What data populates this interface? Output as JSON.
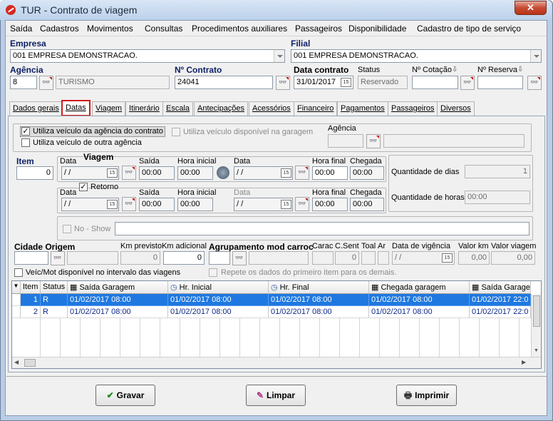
{
  "window": {
    "title": "TUR - Contrato de viagem",
    "close": "✕"
  },
  "menu": [
    "Saída",
    "Cadastros",
    "Movimentos",
    "Consultas",
    "Procedimentos auxiliares",
    "Passageiros",
    "Disponibilidade",
    "Cadastro de tipo de serviço"
  ],
  "header": {
    "empresa_label": "Empresa",
    "empresa_value": "001 EMPRESA DEMONSTRACAO.",
    "filial_label": "Filial",
    "filial_value": "001 EMPRESA DEMONSTRACAO.",
    "agencia_label": "Agência",
    "agencia_code": "8",
    "agencia_name": "TURISMO",
    "contrato_label": "Nº Contrato",
    "contrato_value": "24041",
    "data_contrato_label": "Data contrato",
    "data_contrato_value": "31/01/2017",
    "status_label": "Status",
    "status_value": "Reservado",
    "cotacao_label": "Nº Cotação",
    "reserva_label": "Nº Reserva"
  },
  "tabs": [
    "Dados gerais",
    "Datas",
    "Viagem",
    "Itinerário",
    "Escala",
    "Antecipações",
    "Acessórios",
    "Financeiro",
    "Pagamentos",
    "Passageiros",
    "Diversos"
  ],
  "datas": {
    "usa_veiculo_agencia": "Utiliza veículo da agência do contrato",
    "usa_veiculo_outra": "Utiliza veículo de outra agência",
    "usa_veiculo_garagem": "Utiliza veículo disponível na garagem",
    "agencia_label": "Agência",
    "item_label": "Item",
    "item_value": "0",
    "viagem_label": "Viagem",
    "retorno_label": "Retorno",
    "data_label": "Data",
    "saida_label": "Saída",
    "hora_inicial_label": "Hora inicial",
    "hora_final_label": "Hora final",
    "chegada_label": "Chegada",
    "empty_date": " /  /",
    "empty_time": "00:00",
    "qtd_dias_label": "Quantidade de dias",
    "qtd_dias_value": "1",
    "qtd_horas_label": "Quantidade de horas",
    "qtd_horas_value": "00:00",
    "noshow_label": "No - Show",
    "cidade_origem_label": "Cidade Origem",
    "km_previsto_label": "Km previsto",
    "km_previsto_value": "0",
    "km_adicional_label": "Km adicional",
    "km_adicional_value": "0",
    "agrupamento_label": "Agrupamento mod carroc",
    "carac_label": "Carac",
    "csent_label": "C.Sent",
    "csent_value": "0",
    "toal_label": "Toal",
    "ar_label": "Ar",
    "vigencia_label": "Data de vigência",
    "valor_km_label": "Valor km",
    "valor_km_value": "0,00",
    "valor_viagem_label": "Valor viagem",
    "valor_viagem_value": "0,00",
    "veic_mot_label": "Veíc/Mot disponível no intervalo das viagens",
    "repete_label": "Repete os dados do primeiro item para os demais."
  },
  "grid": {
    "columns": [
      "Item",
      "Status",
      "Saída Garagem",
      "Hr. Inicial",
      "Hr. Final",
      "Chegada garagem",
      "Saída Garagem"
    ],
    "rows": [
      [
        "1",
        "R",
        "01/02/2017 08:00",
        "01/02/2017 08:00",
        "01/02/2017 08:00",
        "01/02/2017 08:00",
        "01/02/2017 22:0"
      ],
      [
        "2",
        "R",
        "01/02/2017 08:00",
        "01/02/2017 08:00",
        "01/02/2017 08:00",
        "01/02/2017 08:00",
        "01/02/2017 22:0"
      ]
    ]
  },
  "buttons": {
    "gravar": "Gravar",
    "limpar": "Limpar",
    "imprimir": "Imprimir"
  },
  "colors": {
    "accent": "#1e78e0",
    "tab_highlight": "#d21a1a",
    "label_blue": "#0c1f66"
  }
}
